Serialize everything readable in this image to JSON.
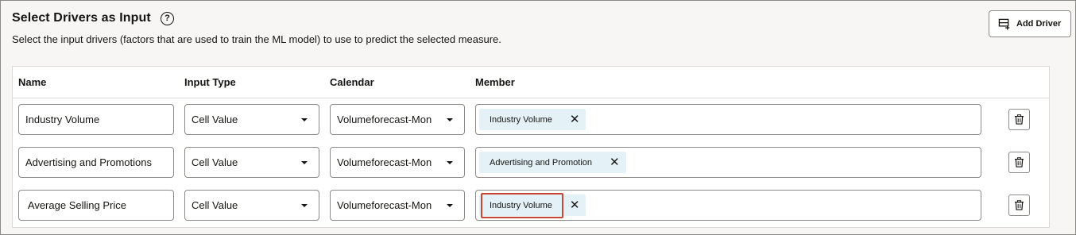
{
  "section": {
    "title": "Select Drivers as Input",
    "help_icon": "help-circle-icon",
    "help_glyph": "?",
    "subtitle": "Select the input drivers (factors that are used to train the ML model) to use to predict the selected measure.",
    "add_driver_label": "Add Driver",
    "add_driver_icon": "add-row-icon"
  },
  "table": {
    "headers": [
      "Name",
      "Input Type",
      "Calendar",
      "Member"
    ],
    "rows": [
      {
        "name": "Industry Volume",
        "input_type": "Cell Value",
        "calendar": "Volumeforecast-Mon",
        "member": "Industry Volume",
        "highlighted": false
      },
      {
        "name": "Advertising and Promotions",
        "input_type": "Cell Value",
        "calendar": "Volumeforecast-Mon",
        "member": "Advertising and Promotion",
        "highlighted": false
      },
      {
        "name": " Average Selling Price",
        "input_type": "Cell Value",
        "calendar": "Volumeforecast-Mon",
        "member": "Industry Volume",
        "highlighted": true
      }
    ],
    "close_glyph": "✕",
    "delete_icon": "trash-icon"
  },
  "colors": {
    "highlight": "#c74634",
    "chip_bg": "#e4f1f7",
    "border": "#8c8a86"
  }
}
